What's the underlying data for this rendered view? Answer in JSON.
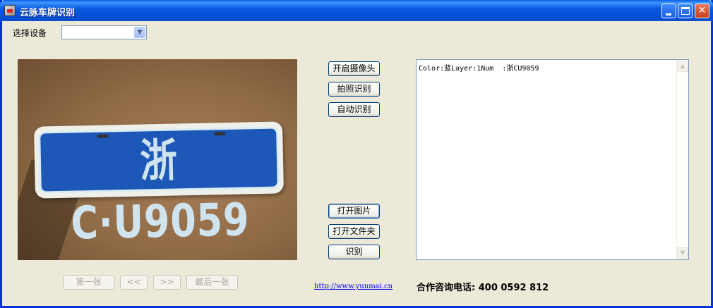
{
  "window": {
    "title": "云脉车牌识别",
    "minimize_icon": "minimize-icon",
    "maximize_icon": "maximize-icon",
    "close_icon": "close-icon"
  },
  "device": {
    "label": "选择设备",
    "selected": ""
  },
  "preview": {
    "plate_text": "浙C·U9059"
  },
  "actions": {
    "open_camera": "开启摄像头",
    "photo_recognize": "拍照识别",
    "auto_recognize": "自动识别",
    "open_image": "打开图片",
    "open_folder": "打开文件夹",
    "recognize": "识别"
  },
  "navigation": {
    "first": "第一张",
    "prev": "<<",
    "next": ">>",
    "last": "最后一张"
  },
  "result": {
    "text": "Color:蓝Layer:1Num  :浙CU9059"
  },
  "footer": {
    "link": "http://www.yunmai.cn",
    "hotline": "合作咨询电话: 400 0592 812"
  },
  "colors": {
    "titlebar": "#0A5BE0",
    "window_bg": "#ECE9D8",
    "plate_blue": "#1D57B8",
    "link": "#0000EE"
  }
}
